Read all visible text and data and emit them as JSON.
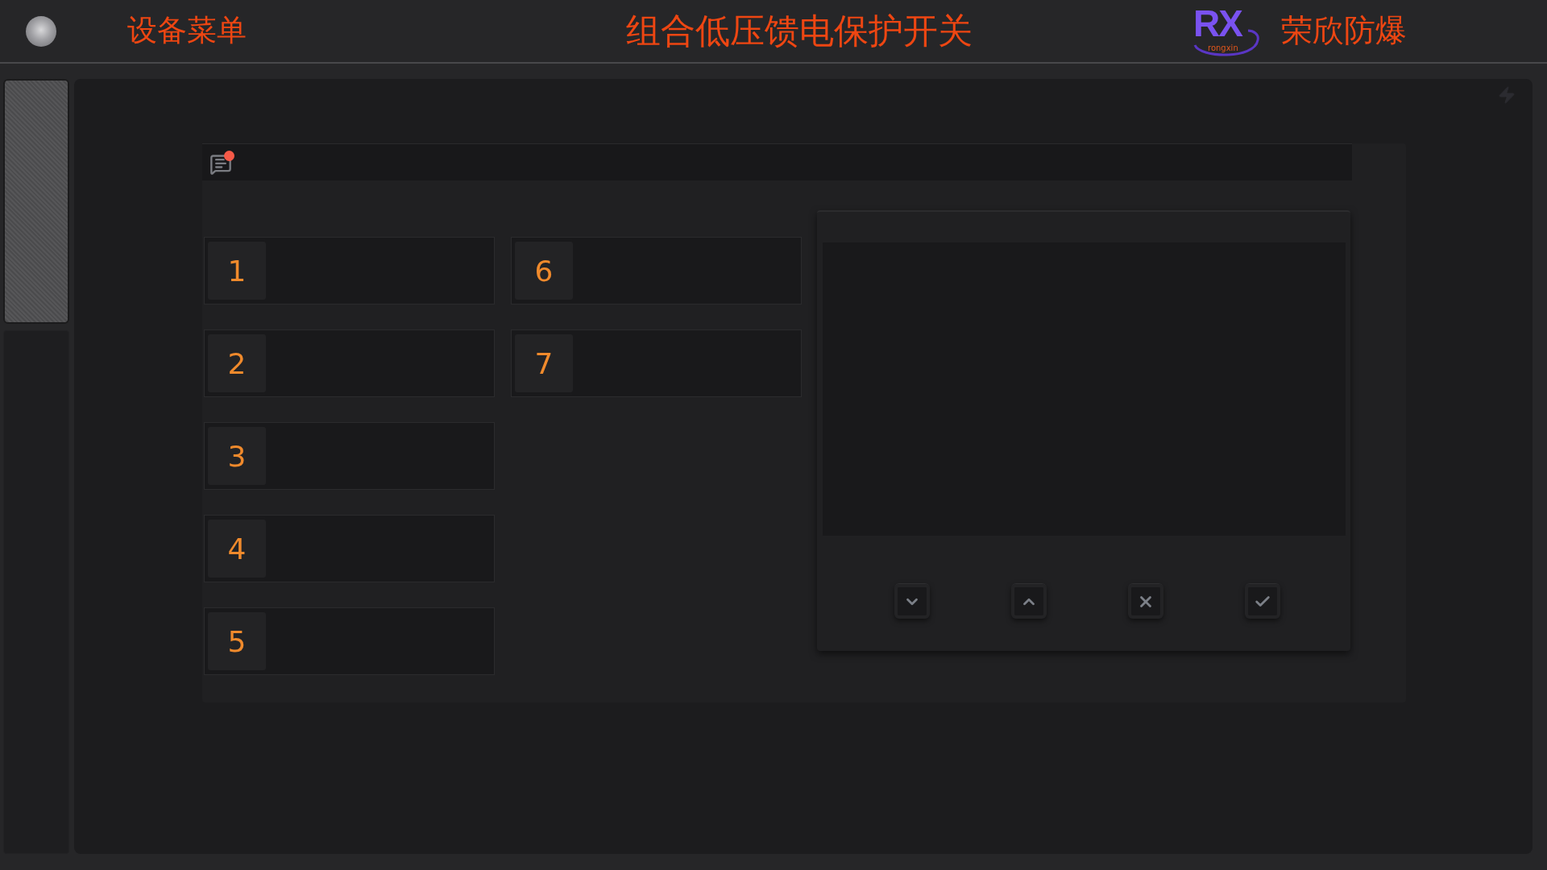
{
  "header": {
    "menu_label": "设备菜单",
    "title": "组合低压馈电保护开关",
    "logo": {
      "letters": "RX",
      "caption": "rongxin"
    },
    "company": "荣欣防爆"
  },
  "panel": {
    "notification": {
      "unread": true
    },
    "slots": [
      {
        "label": "1"
      },
      {
        "label": "2"
      },
      {
        "label": "3"
      },
      {
        "label": "4"
      },
      {
        "label": "5"
      },
      {
        "label": "6"
      },
      {
        "label": "7"
      }
    ],
    "controls": [
      {
        "kind": "down"
      },
      {
        "kind": "up"
      },
      {
        "kind": "cancel"
      },
      {
        "kind": "confirm"
      }
    ]
  }
}
